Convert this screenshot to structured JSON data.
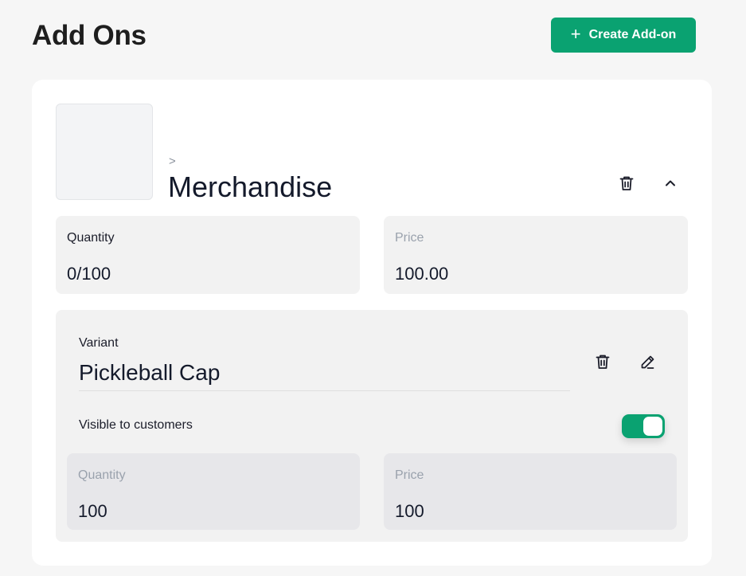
{
  "header": {
    "title": "Add Ons",
    "create_button_label": "Create Add-on",
    "create_button_icon": "plus-icon"
  },
  "addon": {
    "breadcrumb": ">",
    "name": "Merchandise",
    "quantity_label": "Quantity",
    "quantity_value": "0/100",
    "price_label": "Price",
    "price_value": "100.00",
    "actions": [
      "trash-icon",
      "chevron-up-icon"
    ]
  },
  "variant": {
    "label": "Variant",
    "name": "Pickleball Cap",
    "visible_label": "Visible to customers",
    "visible": true,
    "quantity_label": "Quantity",
    "quantity_value": "100",
    "price_label": "Price",
    "price_value": "100",
    "actions": [
      "trash-icon",
      "pencil-icon"
    ]
  },
  "colors": {
    "accent": "#0aa271",
    "background": "#f6f6f6",
    "card": "#ffffff",
    "panel": "#f2f2f2",
    "field": "#e7e7ea",
    "muted_text": "#9aa2ad"
  }
}
